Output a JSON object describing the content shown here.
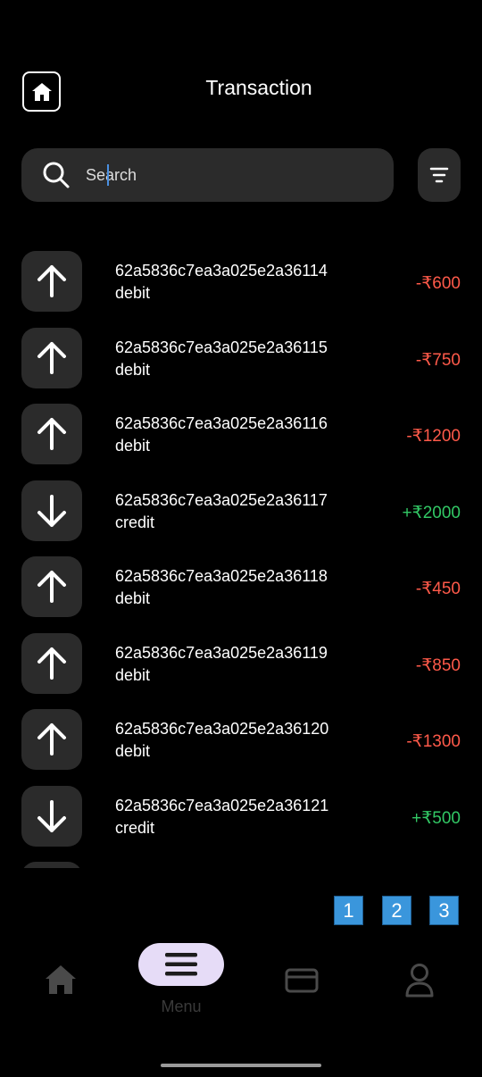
{
  "header": {
    "title": "Transaction"
  },
  "search": {
    "placeholder": "Search"
  },
  "transactions": [
    {
      "id": "62a5836c7ea3a025e2a36114",
      "type": "debit",
      "amount": "-₹600"
    },
    {
      "id": "62a5836c7ea3a025e2a36115",
      "type": "debit",
      "amount": "-₹750"
    },
    {
      "id": "62a5836c7ea3a025e2a36116",
      "type": "debit",
      "amount": "-₹1200"
    },
    {
      "id": "62a5836c7ea3a025e2a36117",
      "type": "credit",
      "amount": "+₹2000"
    },
    {
      "id": "62a5836c7ea3a025e2a36118",
      "type": "debit",
      "amount": "-₹450"
    },
    {
      "id": "62a5836c7ea3a025e2a36119",
      "type": "debit",
      "amount": "-₹850"
    },
    {
      "id": "62a5836c7ea3a025e2a36120",
      "type": "debit",
      "amount": "-₹1300"
    },
    {
      "id": "62a5836c7ea3a025e2a36121",
      "type": "credit",
      "amount": "+₹500"
    }
  ],
  "pagination": {
    "pages": [
      "1",
      "2",
      "3"
    ]
  },
  "nav": {
    "menu_label": "Menu",
    "icons": [
      "home-icon",
      "menu-icon",
      "card-icon",
      "profile-icon"
    ]
  },
  "colors": {
    "background": "#000000",
    "surface": "#2b2b2b",
    "debit": "#ff5a4a",
    "credit": "#32c865",
    "page_button": "#3a96dc",
    "menu_pill": "#e6dcf7"
  }
}
